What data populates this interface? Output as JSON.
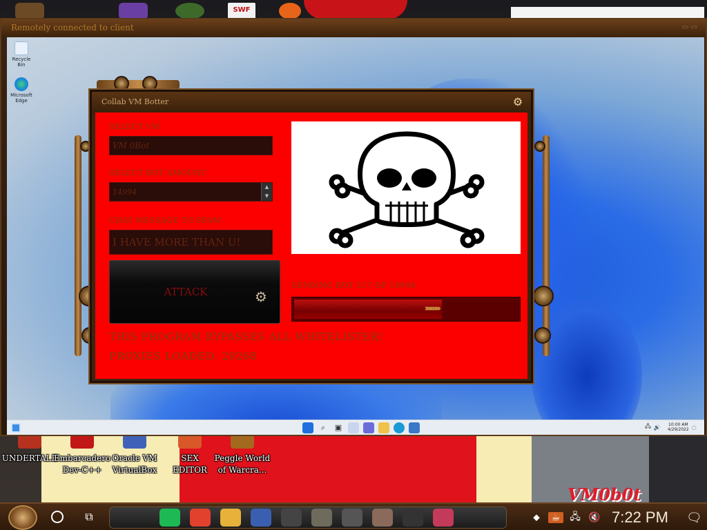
{
  "host": {
    "desktop_icons": [
      {
        "label": "UNDERTALE",
        "icon": "undertale-icon",
        "color": "#b6321f"
      },
      {
        "label": "Embarcadero\nDev-C++",
        "icon": "devcpp-icon",
        "color": "#c21717"
      },
      {
        "label": "Oracle VM\nVirtualBox",
        "icon": "virtualbox-icon",
        "color": "#3f62b8"
      },
      {
        "label": "SEX\nEDITOR",
        "icon": "sex-editor-icon",
        "color": "#d8582a"
      },
      {
        "label": "Peggle World\nof Warcra...",
        "icon": "peggle-icon",
        "color": "#a3691f"
      }
    ],
    "watermark": "VM0b0t",
    "clock": "7:22 PM",
    "pinned_apps": [
      {
        "icon": "spotify-icon",
        "color": "#1db954"
      },
      {
        "icon": "chrome-icon",
        "color": "#e2412e"
      },
      {
        "icon": "file-explorer-icon",
        "color": "#e8b13a"
      },
      {
        "icon": "virtualbox-icon",
        "color": "#3b5fb0"
      },
      {
        "icon": "help-icon",
        "color": "#444444"
      },
      {
        "icon": "gimp-icon",
        "color": "#6e6a5c"
      },
      {
        "icon": "skull-app-icon",
        "color": "#555555"
      },
      {
        "icon": "portrait-app-icon",
        "color": "#8a6a5a"
      },
      {
        "icon": "unity-icon",
        "color": "#333333"
      },
      {
        "icon": "installer-icon",
        "color": "#c43a5a"
      }
    ]
  },
  "remote": {
    "title": "Remotely connected to client",
    "vm_desktop_icons": [
      {
        "label": "Recycle Bin",
        "icon": "recycle-bin-icon"
      },
      {
        "label": "Microsoft Edge",
        "icon": "edge-icon"
      }
    ],
    "vm_clock_time": "10:00 AM",
    "vm_clock_date": "4/29/2022"
  },
  "app": {
    "title": "Collab VM Botter",
    "select_vm_label": "SELECT VM",
    "select_vm_value": "VM 0Bot",
    "bot_amount_label": "SELECT BOT AMOUNT",
    "bot_amount_value": "14994",
    "chat_label": "CHAT MESSAGE TO SPAM",
    "chat_value": "I HAVE MORE THAN U!",
    "attack_label": "ATTACK",
    "sending_status": "SENDING BOT 217 OF 14994",
    "progress_fraction": 0.66,
    "bypass_note": "THIS PROGRAM BYPASSES ALL WHITELISTER!",
    "proxies_note": "PROXIES LOADED: 29268",
    "accent_color": "#fc0000"
  }
}
